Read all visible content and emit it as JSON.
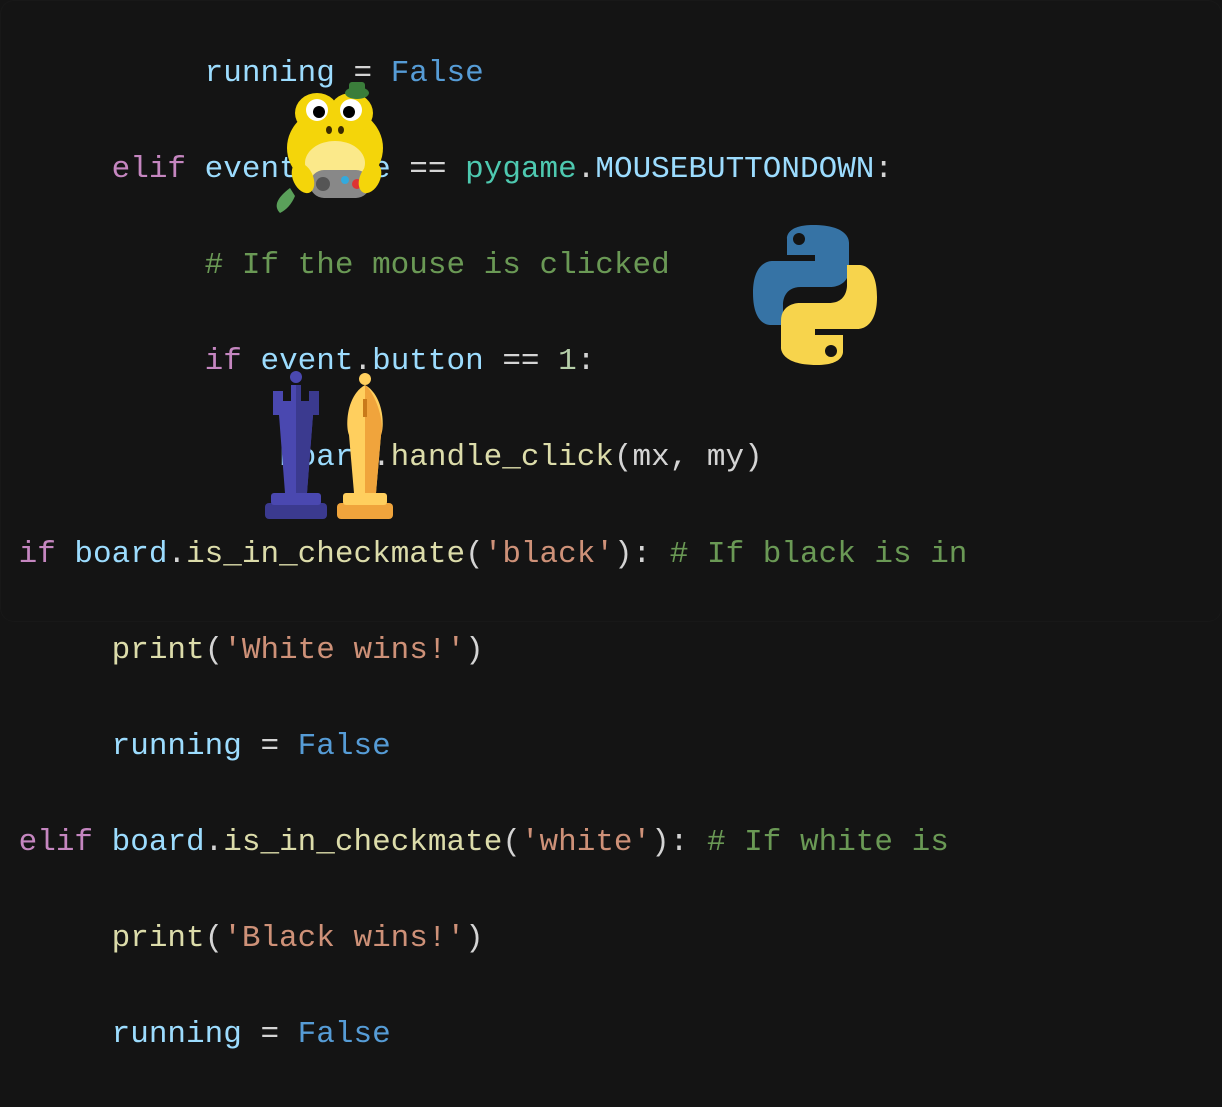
{
  "code": {
    "line1_running": "running",
    "line1_eq": " = ",
    "line1_false": "False",
    "line2_elif": "elif",
    "line2_event": " event",
    "line2_dot1": ".",
    "line2_type": "type",
    "line2_eqeq": " == ",
    "line2_pygame": "pygame",
    "line2_dot2": ".",
    "line2_mousebutton": "MOUSEBUTTONDOWN",
    "line2_colon": ":",
    "line3_comment": "# If the mouse is clicked",
    "line4_if": "if",
    "line4_event": " event",
    "line4_dot": ".",
    "line4_button": "button",
    "line4_eqeq": " == ",
    "line4_one": "1",
    "line4_colon": ":",
    "line5_board": "board",
    "line5_dot": ".",
    "line5_handle": "handle_click",
    "line5_paren": "(mx, my)",
    "line6_if": "if",
    "line6_board": " board",
    "line6_dot": ".",
    "line6_method": "is_in_checkmate",
    "line6_paren1": "(",
    "line6_str": "'black'",
    "line6_paren2": "): ",
    "line6_comment": "# If black is in",
    "line7_print": "print",
    "line7_paren1": "(",
    "line7_str": "'White wins!'",
    "line7_paren2": ")",
    "line8_running": "running",
    "line8_eq": " = ",
    "line8_false": "False",
    "line9_elif": "elif",
    "line9_board": " board",
    "line9_dot": ".",
    "line9_method": "is_in_checkmate",
    "line9_paren1": "(",
    "line9_str": "'white'",
    "line9_paren2": "): ",
    "line9_comment": "# If white is ",
    "line10_print": "print",
    "line10_paren1": "(",
    "line10_str": "'Black wins!'",
    "line10_paren2": ")",
    "line11_running": "running",
    "line11_eq": " = ",
    "line11_false": "False"
  },
  "icons": {
    "pygame_mascot": "pygame-snake-mascot",
    "python_logo": "python-logo",
    "chess_pieces": "chess-pieces"
  }
}
